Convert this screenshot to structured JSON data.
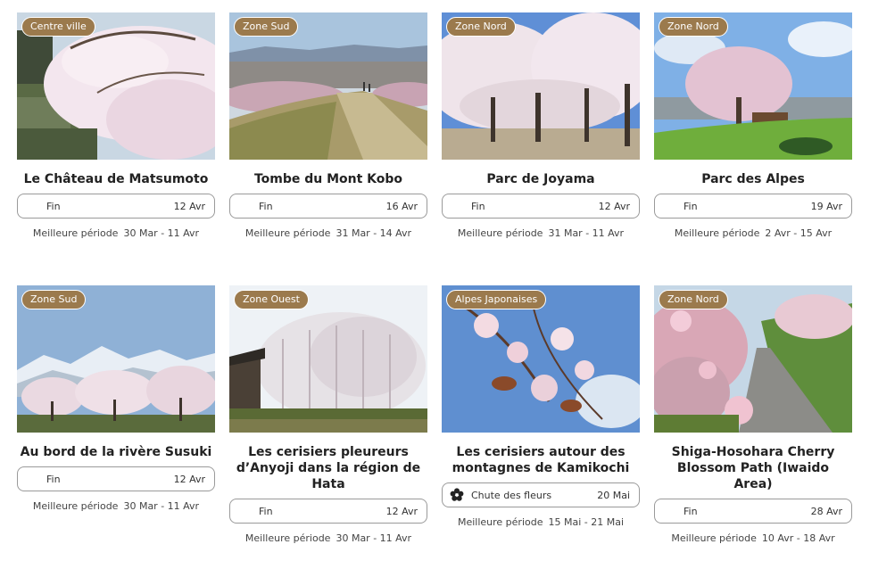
{
  "best_period_label": "Meilleure période",
  "cards": [
    {
      "zone": "Centre ville",
      "title": "Le Château de Matsumoto",
      "status": "Fin",
      "date": "12 Avr",
      "period": "30 Mar - 11 Avr",
      "photo": "castle-moat-cherry-trees"
    },
    {
      "zone": "Zone Sud",
      "title": "Tombe du Mont Kobo",
      "status": "Fin",
      "date": "16 Avr",
      "period": "31 Mar - 14 Avr",
      "photo": "hill-path-city-view"
    },
    {
      "zone": "Zone Nord",
      "title": "Parc de Joyama",
      "status": "Fin",
      "date": "12 Avr",
      "period": "31 Mar - 11 Avr",
      "photo": "park-cherry-trees"
    },
    {
      "zone": "Zone Nord",
      "title": "Parc des Alpes",
      "status": "Fin",
      "date": "19 Avr",
      "period": "2 Avr - 15 Avr",
      "photo": "single-cherry-tree-lawn"
    },
    {
      "zone": "Zone Sud",
      "title": "Au bord de la rivère Susuki",
      "status": "Fin",
      "date": "12 Avr",
      "period": "30 Mar - 11 Avr",
      "photo": "snowy-alps-riverbank"
    },
    {
      "zone": "Zone Ouest",
      "title": "Les cerisiers pleureurs d’Anyoji dans la région de Hata",
      "status": "Fin",
      "date": "12 Avr",
      "period": "30 Mar - 11 Avr",
      "photo": "weeping-cherry-temple"
    },
    {
      "zone": "Alpes Japonaises",
      "title": "Les cerisiers autour des montagnes de Kamikochi",
      "status": "Chute des fleurs",
      "date": "20 Mai",
      "period": "15 Mai - 21 Mai",
      "photo": "cherry-blossom-closeup",
      "flower_icon": true
    },
    {
      "zone": "Zone Nord",
      "title": "Shiga-Hosohara Cherry Blossom Path (Iwaido Area)",
      "status": "Fin",
      "date": "28 Avr",
      "period": "10 Avr - 18 Avr",
      "photo": "blossom-path-hillside"
    }
  ]
}
